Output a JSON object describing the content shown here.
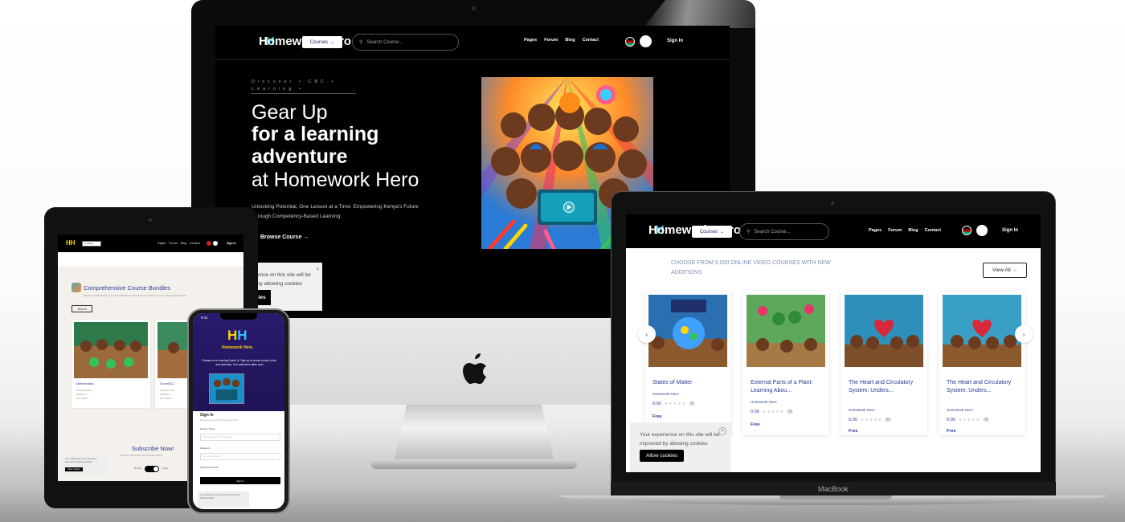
{
  "brand": {
    "logo_text": "HH",
    "logo_sub": "Homework Hero"
  },
  "nav": {
    "courses_label": "Courses",
    "search_placeholder": "Search Course...",
    "links": [
      "Pages",
      "Forum",
      "Blog",
      "Contact"
    ],
    "sign_in": "Sign In"
  },
  "hero": {
    "discover": "Discover • CBC • Learning •",
    "line1": "Gear Up",
    "line2": "for a learning",
    "line3": "adventure",
    "line4": "at Homework Hero",
    "description": "Unlocking Potential, One Lesson at a Time: Empowering Kenya's Future Through Competency-Based Learning",
    "browse": "Browse Course →"
  },
  "imac_cookie": {
    "text": "ence on this site will be by allowing cookies",
    "button": "kies",
    "close": "×"
  },
  "ipad": {
    "bundle_title": "Comprehensive Course Bundles",
    "bundle_desc": "Explore a Wide Range of Curated Educational Resources to Enhance Your Learning Experience",
    "view_all": "View All",
    "cards": [
      {
        "title": "Mathematics",
        "meta": "Homework Hero\nStarrates: 0\nPrice: KES 0"
      },
      {
        "title": "GroceBCC",
        "meta": "Homework Hero\nStarrates: 0\nPrice: KES 0"
      }
    ],
    "subscribe": "Subscribe Now!",
    "subscribe_desc": "Choose a subscription plan and save money!",
    "toggle_left": "Monthly",
    "toggle_right": "Yearly",
    "cookie_text": "Your experience on this site will be improved by allowing cookies",
    "cookie_btn": "Allow cookies"
  },
  "iphone": {
    "time": "9:41",
    "brand": "Homework Hero",
    "tagline": "Embark on a Learning Quest! 🚀 Sign up to unlock a world of fun and discovery. Your adventure starts now!",
    "signin_title": "Sign In",
    "signin_sub": "Don't have an account? Create an Account",
    "email_label": "Email or Phone",
    "email_placeholder": "Type your email or phone number",
    "password_label": "Password",
    "password_placeholder": "Type your password",
    "forgot": "Forgot Password?",
    "signin_btn": "Sign In",
    "cookie_text": "Your experience on this site will be improved by allowing cookies"
  },
  "macbook": {
    "choose": "CHOOSE FROM 5,000 ONLINE VIDEO COURSES WITH NEW ADDITIONS",
    "view_all": "View All →",
    "cards": [
      {
        "title": "States of Matter",
        "author": "Homework Hero",
        "rating": "0.00",
        "count": "(0)",
        "price": "Free"
      },
      {
        "title": "External Parts of a Plant: Learning Abou...",
        "author": "Homework Hero",
        "rating": "0.00",
        "count": "(0)",
        "price": "Free"
      },
      {
        "title": "The Heart and Circulatory System: Unders...",
        "author": "Homework Hero",
        "rating": "0.00",
        "count": "(0)",
        "price": "Free"
      },
      {
        "title": "The Heart and Circulatory System: Unders...",
        "author": "Homework Hero",
        "rating": "0.00",
        "count": "(0)",
        "price": "Free"
      }
    ],
    "stars": "★★★★★",
    "cookie_text": "Your experience on this site will be improved by allowing cookies",
    "cookie_btn": "Allow cookies",
    "close": "×",
    "laptop_label": "MacBook"
  },
  "colors": {
    "accent_blue": "#2b3a8f",
    "logo_yellow": "#ffd400",
    "logo_cyan": "#2ec5ff",
    "hero_bg": "#000000"
  }
}
